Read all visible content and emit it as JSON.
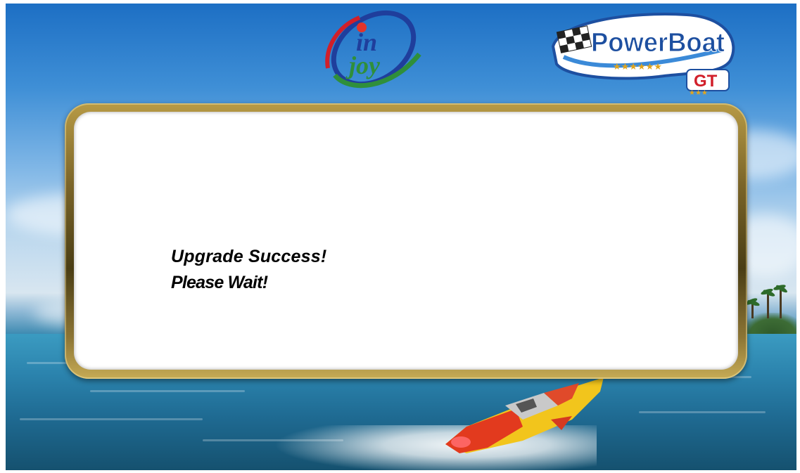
{
  "logos": {
    "left_logo_text": [
      "in",
      "joy"
    ],
    "right_logo_text": "PowerBoat",
    "right_logo_suffix": "GT"
  },
  "dialog": {
    "line1": "Upgrade Success!",
    "line2": "Please Wait!"
  },
  "colors": {
    "frame_gold": "#8c7535",
    "dialog_bg": "#ffffff",
    "text": "#000000",
    "injoy_blue": "#1f3e9c",
    "injoy_green": "#2f8f3a",
    "injoy_red": "#d11f2a"
  }
}
